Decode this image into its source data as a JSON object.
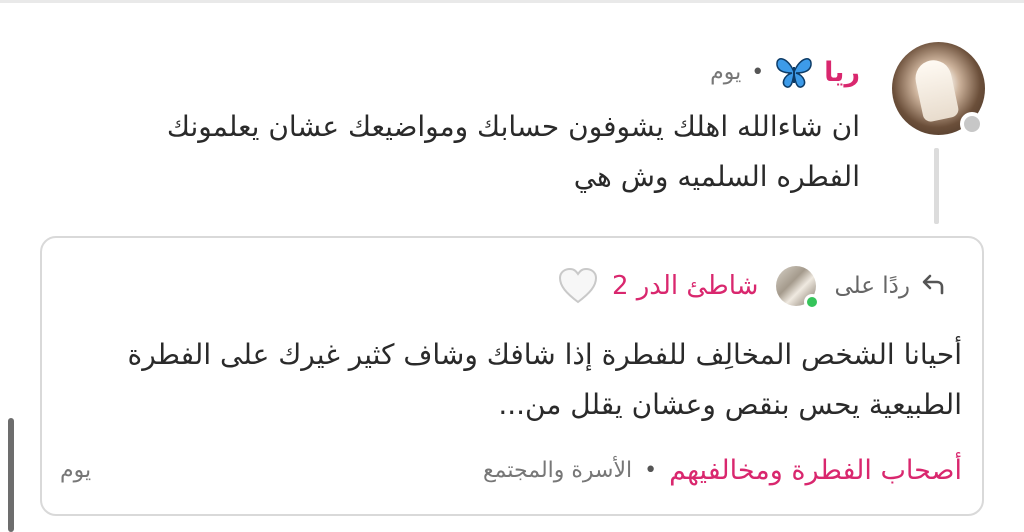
{
  "post": {
    "author": "ريا",
    "time": "يوم",
    "separator": "•",
    "author_badge_icon": "butterfly-icon",
    "text_line1": "ان شاءالله اهلك يشوفون حسابك ومواضيعك عشان يعلمونك",
    "text_line2": "الفطره السلميه وش هي"
  },
  "reply": {
    "label": "ردًا على",
    "reply_icon": "reply-arrow-icon",
    "user": "شاطئ الدر 2",
    "user_badge_icon": "white-heart-icon",
    "online_color": "#35c45a",
    "text_line1": "أحيانا الشخص المخالِف للفطرة إذا شافك وشاف كثير غيرك على الفطرة",
    "text_line2": "الطبيعية يحس بنقص وعشان يقلل من..."
  },
  "footer": {
    "community": "أصحاب الفطرة ومخالفيهم",
    "separator": "•",
    "category": "الأسرة والمجتمع",
    "time": "يوم"
  },
  "colors": {
    "accent": "#d9276e",
    "muted": "#777777",
    "border": "#d9d9d9"
  }
}
